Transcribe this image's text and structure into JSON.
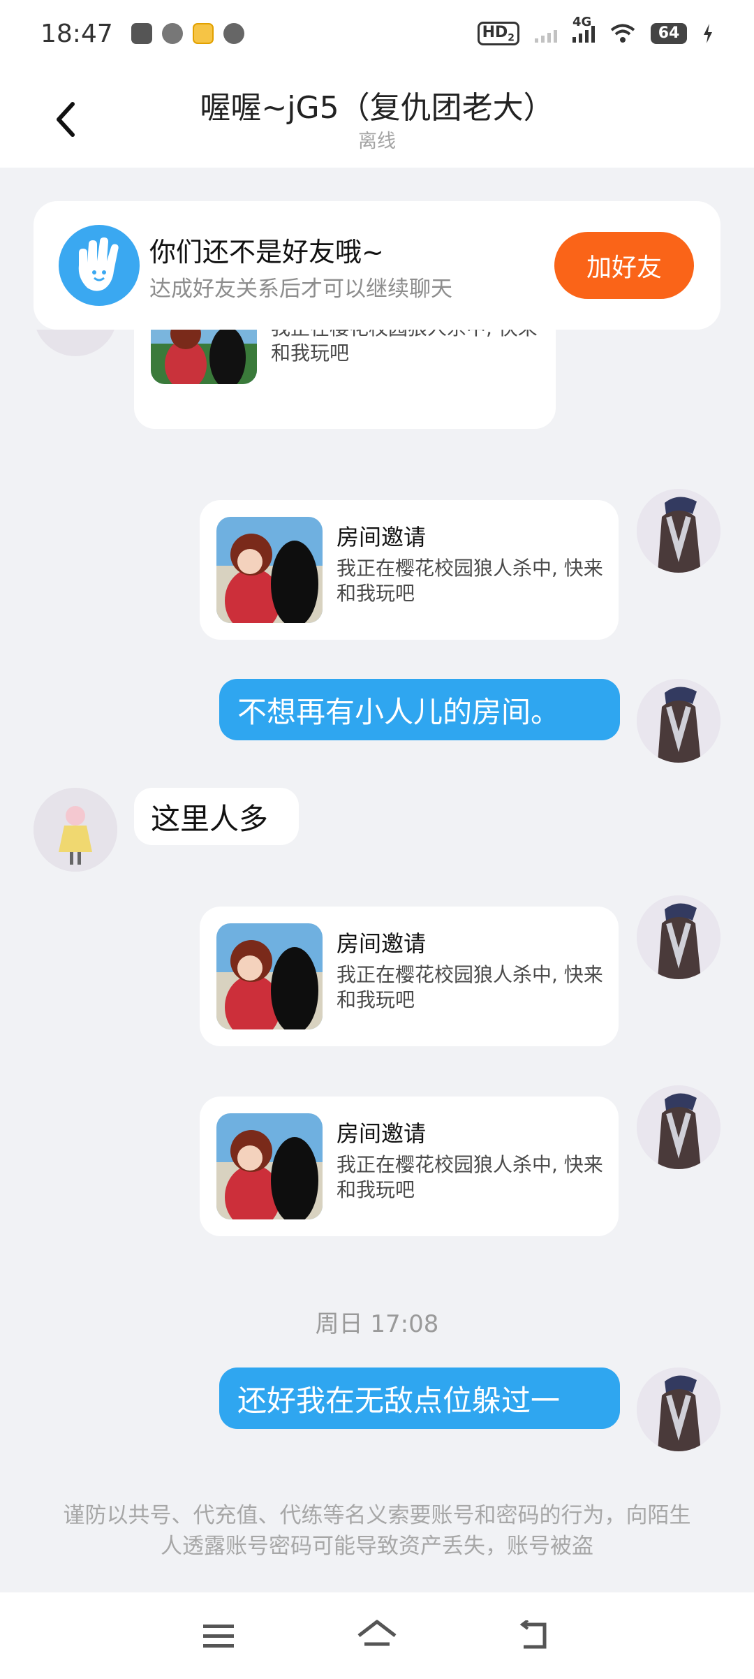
{
  "status_bar": {
    "time": "18:47",
    "hd_label": "HD",
    "hd_sub": "2",
    "network": "4G",
    "battery": "64"
  },
  "header": {
    "title": "喔喔~jG5（复仇团老大）",
    "status": "离线"
  },
  "friend_prompt": {
    "title": "你们还不是好友哦~",
    "desc": "达成好友关系后才可以继续聊天",
    "button": "加好友"
  },
  "messages": {
    "invite_title": "房间邀请",
    "invite_desc": "我正在樱花校园狼人杀中, 快来和我玩吧",
    "partial_desc": "我正在樱花校园狼人杀中, 快来和我玩吧",
    "text1": "不想再有小人儿的房间。",
    "text2": "这里人多",
    "timestamp": "周日 17:08",
    "text3": "还好我在无敌点位躲过一"
  },
  "warning": "谨防以共号、代充值、代练等名义索要账号和密码的行为，向陌生人透露账号密码可能导致资产丢失，账号被盗",
  "colors": {
    "accent_blue": "#2fa6f0",
    "add_button": "#fa6418",
    "background": "#f1f2f5"
  },
  "icons": [
    "back-arrow-icon",
    "waving-hand-icon",
    "menu-icon",
    "home-icon",
    "return-icon"
  ]
}
